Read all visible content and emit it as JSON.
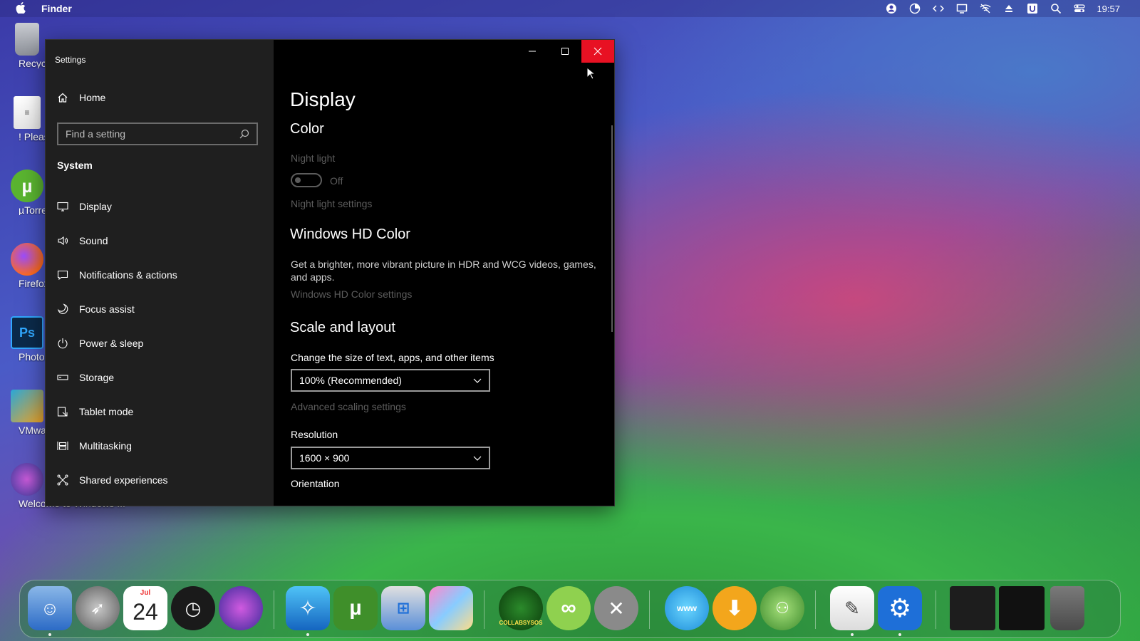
{
  "menubar": {
    "app_name": "Finder",
    "clock": "19:57",
    "status_icons": [
      "user-icon",
      "piechart-icon",
      "code-icon",
      "display-icon",
      "wifi-off-icon",
      "eject-icon",
      "u-icon",
      "search-icon",
      "control-center-icon"
    ]
  },
  "desktop": {
    "icons": [
      {
        "label": "Recycle Bin",
        "name": "recycle-bin-icon"
      },
      {
        "label": "! Please Read",
        "name": "notepad-icon"
      },
      {
        "label": "µTorrent",
        "name": "utorrent-icon"
      },
      {
        "label": "Firefox",
        "name": "firefox-icon"
      },
      {
        "label": "Photoshop",
        "name": "photoshop-icon"
      },
      {
        "label": "VMware Workstation",
        "name": "vmware-icon"
      },
      {
        "label": "Welcome to Windows ...",
        "name": "welcome-icon"
      }
    ]
  },
  "window": {
    "title": "Settings",
    "caption": {
      "minimize": "minimize",
      "maximize": "maximize",
      "close": "close"
    }
  },
  "sidebar": {
    "home_label": "Home",
    "search_placeholder": "Find a setting",
    "section_title": "System",
    "items": [
      {
        "label": "Display",
        "icon": "monitor-icon"
      },
      {
        "label": "Sound",
        "icon": "speaker-icon"
      },
      {
        "label": "Notifications & actions",
        "icon": "notification-icon"
      },
      {
        "label": "Focus assist",
        "icon": "moon-icon"
      },
      {
        "label": "Power & sleep",
        "icon": "power-icon"
      },
      {
        "label": "Storage",
        "icon": "storage-icon"
      },
      {
        "label": "Tablet mode",
        "icon": "tablet-icon"
      },
      {
        "label": "Multitasking",
        "icon": "multitasking-icon"
      },
      {
        "label": "Shared experiences",
        "icon": "shared-icon"
      }
    ]
  },
  "content": {
    "page_title": "Display",
    "color_heading": "Color",
    "night_light_label": "Night light",
    "night_light_state": "Off",
    "night_light_settings": "Night light settings",
    "hd_heading": "Windows HD Color",
    "hd_description": "Get a brighter, more vibrant picture in HDR and WCG videos, games, and apps.",
    "hd_settings": "Windows HD Color settings",
    "scale_heading": "Scale and layout",
    "scale_label": "Change the size of text, apps, and other items",
    "scale_value": "100% (Recommended)",
    "advanced_scaling": "Advanced scaling settings",
    "resolution_label": "Resolution",
    "resolution_value": "1600 × 900",
    "orientation_label": "Orientation"
  },
  "dock": {
    "calendar_month": "Jul",
    "calendar_day": "24",
    "collab_label": "COLLABSYSOS"
  },
  "colors": {
    "close_red": "#e81123",
    "sidebar_bg": "#1f1f1f",
    "content_bg": "#000000",
    "muted_text": "#5c5c5c"
  }
}
